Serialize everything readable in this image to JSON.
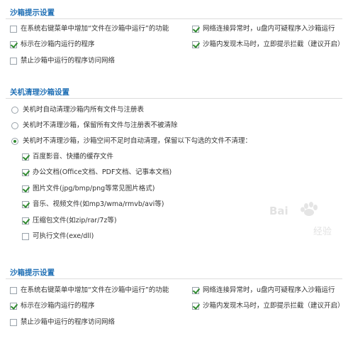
{
  "section1": {
    "title": "沙箱提示设置",
    "options": [
      {
        "label": "在系统右键菜单中增加“文件在沙箱中运行”的功能",
        "checked": false
      },
      {
        "label": "网络连接异常时，u盘内可疑程序入沙箱运行",
        "checked": true
      },
      {
        "label": "标示在沙箱内运行的程序",
        "checked": true
      },
      {
        "label": "沙箱内发现木马时，立即提示拦截（建议开启）",
        "checked": true
      },
      {
        "label": "禁止沙箱中运行的程序访问网络",
        "checked": false
      }
    ]
  },
  "section2": {
    "title": "关机清理沙箱设置",
    "radios": [
      {
        "label": "关机时自动清理沙箱内所有文件与注册表",
        "checked": false
      },
      {
        "label": "关机时不清理沙箱，保留所有文件与注册表不被清除",
        "checked": false
      },
      {
        "label": "关机时不清理沙箱，沙箱空间不足时自动清理，保留以下勾选的文件不清理：",
        "checked": true
      }
    ],
    "file_types": [
      {
        "label": "百度影音、快播的缓存文件",
        "checked": true
      },
      {
        "label": "办公文档(Office文档、PDF文档、记事本文档)",
        "checked": true
      },
      {
        "label": "图片文件(jpg/bmp/png等常见图片格式)",
        "checked": true
      },
      {
        "label": "音乐、视频文件(如mp3/wma/rmvb/avi等)",
        "checked": true
      },
      {
        "label": "压缩包文件(如zip/rar/7z等)",
        "checked": true
      },
      {
        "label": "可执行文件(exe/dll)",
        "checked": false
      }
    ]
  },
  "section3": {
    "title": "沙箱提示设置",
    "options": [
      {
        "label": "在系统右键菜单中增加“文件在沙箱中运行”的功能",
        "checked": false
      },
      {
        "label": "网络连接异常时，u盘内可疑程序入沙箱运行",
        "checked": true
      },
      {
        "label": "标示在沙箱内运行的程序",
        "checked": true
      },
      {
        "label": "沙箱内发现木马时，立即提示拦截（建议开启）",
        "checked": true
      },
      {
        "label": "禁止沙箱中运行的程序访问网络",
        "checked": false
      }
    ]
  },
  "watermark": {
    "text_top": "Bai",
    "text_bottom": "经验",
    "icon": "baidu-paw-icon"
  },
  "colors": {
    "title": "#1f6fb5",
    "check": "#2f8a2f",
    "divider": "#dcdcdc"
  }
}
